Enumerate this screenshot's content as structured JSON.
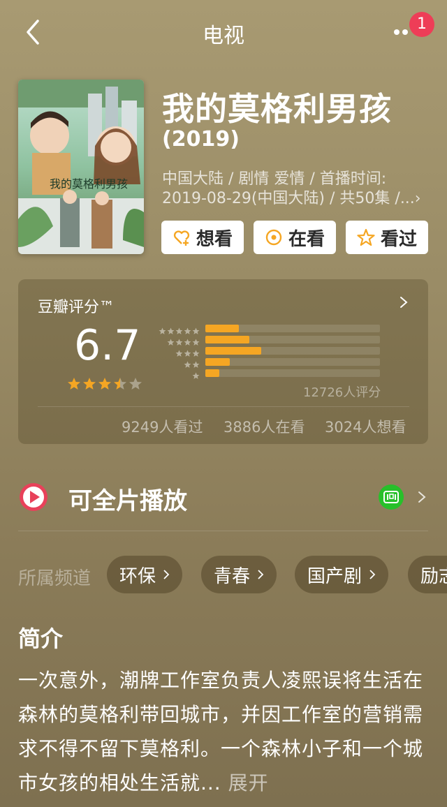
{
  "header": {
    "title": "电视",
    "badge_count": "1"
  },
  "movie": {
    "title": "我的莫格利男孩",
    "year": "(2019)",
    "meta_line1": "中国大陆 / 剧情 爱情 / 首播时间:",
    "meta_line2": "2019-08-29(中国大陆) / 共50集 /...›",
    "poster_text": "我的莫格利男孩"
  },
  "actions": [
    {
      "label": "想看",
      "icon": "heart-plus-icon"
    },
    {
      "label": "在看",
      "icon": "target-icon"
    },
    {
      "label": "看过",
      "icon": "star-outline-icon"
    }
  ],
  "rating": {
    "title": "豆瓣评分™",
    "score": "6.7",
    "stars": 3.5,
    "distribution": [
      {
        "stars": 5,
        "fraction": 0.19
      },
      {
        "stars": 4,
        "fraction": 0.25
      },
      {
        "stars": 3,
        "fraction": 0.32
      },
      {
        "stars": 2,
        "fraction": 0.14
      },
      {
        "stars": 1,
        "fraction": 0.08
      }
    ],
    "count": "12726人评分",
    "watched": "9249人看过",
    "watching": "3886人在看",
    "want": "3024人想看"
  },
  "play": {
    "label": "可全片播放",
    "provider": "iQIYI"
  },
  "channels": {
    "label": "所属频道",
    "items": [
      "环保",
      "青春",
      "国产剧",
      "励志"
    ]
  },
  "intro": {
    "heading": "简介",
    "text": "一次意外，潮牌工作室负责人凌熙误将生活在森林的莫格利带回城市，并因工作室的营销需求不得不留下莫格利。一个森林小子和一个城市女孩的相处生活就...",
    "expand": "展开"
  },
  "colors": {
    "accent": "#f5a623",
    "badge": "#ee3d57",
    "play": "#e8415a",
    "iqiyi": "#27c02a"
  }
}
